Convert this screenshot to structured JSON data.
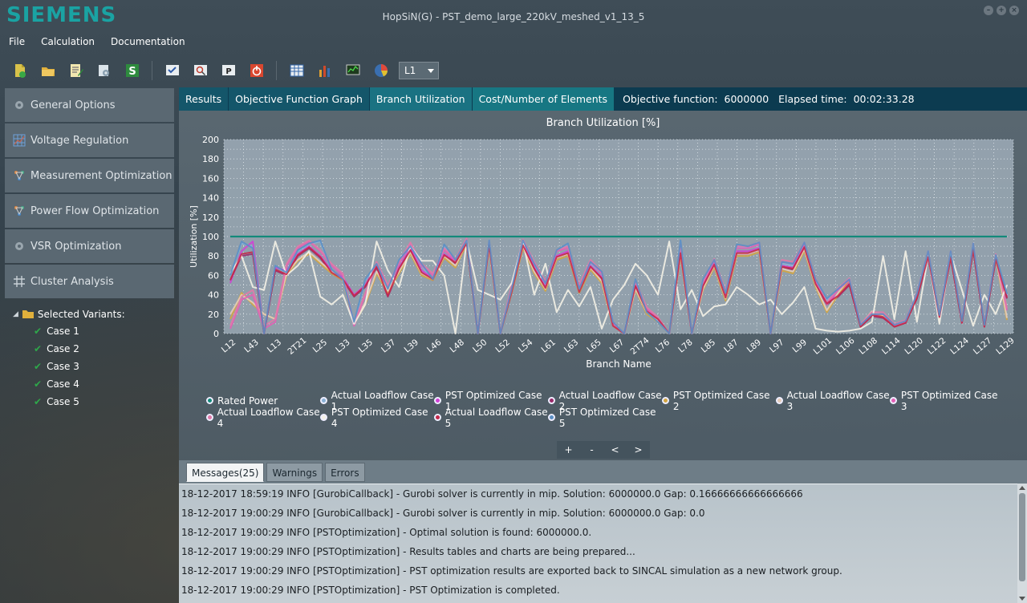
{
  "app": {
    "logo": "SIEMENS",
    "window_title": "HopSiN(G) - PST_demo_large_220kV_meshed_v1_13_5"
  },
  "menu": [
    "File",
    "Calculation",
    "Documentation"
  ],
  "toolbar": {
    "icons": [
      "new-file-icon",
      "open-folder-icon",
      "edit-document-icon",
      "settings-icon",
      "sincal-s-icon",
      "view-check-icon",
      "search-settings-icon",
      "print-p-icon",
      "power-stop-icon",
      "table-view-icon",
      "bar-chart-icon",
      "monitor-graph-icon",
      "pie-chart-icon"
    ],
    "level_select": "L1"
  },
  "sidebar": {
    "items": [
      {
        "label": "General Options",
        "icon": "gear-icon"
      },
      {
        "label": "Voltage Regulation",
        "icon": "grid-chart-icon"
      },
      {
        "label": "Measurement Optimization",
        "icon": "network-nodes-icon"
      },
      {
        "label": "Power Flow Optimization",
        "icon": "network-nodes-icon"
      },
      {
        "label": "VSR Optimization",
        "icon": "gear-icon"
      },
      {
        "label": "Cluster Analysis",
        "icon": "hash-grid-icon"
      }
    ],
    "tree": {
      "root_label": "Selected Variants:",
      "cases": [
        "Case 1",
        "Case 2",
        "Case 3",
        "Case 4",
        "Case 5"
      ]
    }
  },
  "tabs": [
    "Results",
    "Objective Function Graph",
    "Branch Utilization",
    "Cost/Number of Elements"
  ],
  "active_tab": "Branch Utilization",
  "objective": {
    "text": "Objective function:  6000000   Elapsed time:  00:02:33.28"
  },
  "chart_nav": [
    "+",
    "-",
    "<",
    ">"
  ],
  "chart_data": {
    "type": "line",
    "title": "Branch Utilization [%]",
    "xlabel": "Branch Name",
    "ylabel": "Utilization [%]",
    "ylim": [
      0,
      200
    ],
    "yticks": [
      0,
      20,
      40,
      60,
      80,
      100,
      120,
      140,
      160,
      180,
      200
    ],
    "grid": true,
    "legend_position": "bottom",
    "x_tick_labels": [
      "L12",
      "L43",
      "L13",
      "2T21",
      "L25",
      "L33",
      "L35",
      "L37",
      "L39",
      "L46",
      "L48",
      "L50",
      "L52",
      "L54",
      "L61",
      "L63",
      "L65",
      "L67",
      "2T74",
      "L76",
      "L78",
      "L85",
      "L87",
      "L89",
      "L97",
      "L99",
      "L101",
      "L106",
      "L108",
      "L114",
      "L120",
      "L122",
      "L124",
      "L127",
      "L129"
    ],
    "series": [
      {
        "name": "Rated Power",
        "color": "#138a7a",
        "values": [
          100,
          100,
          100,
          100,
          100,
          100,
          100,
          100,
          100,
          100,
          100,
          100,
          100,
          100,
          100,
          100,
          100,
          100,
          100,
          100,
          100,
          100,
          100,
          100,
          100,
          100,
          100,
          100,
          100,
          100,
          100,
          100,
          100,
          100,
          100,
          100,
          100,
          100,
          100,
          100,
          100,
          100,
          100,
          100,
          100,
          100,
          100,
          100,
          100,
          100,
          100,
          100,
          100,
          100,
          100,
          100,
          100,
          100,
          100,
          100,
          100,
          100,
          100,
          100,
          100,
          100,
          100,
          100,
          100,
          100
        ]
      },
      {
        "name": "Actual Loadflow Case 1",
        "color": "#8ab2d6",
        "values": [
          60,
          93,
          90,
          0,
          70,
          62,
          85,
          92,
          95,
          65,
          55,
          10,
          55,
          70,
          45,
          75,
          88,
          70,
          55,
          90,
          75,
          95,
          0,
          95,
          0,
          45,
          95,
          70,
          50,
          85,
          92,
          45,
          72,
          62,
          10,
          0,
          55,
          20,
          12,
          0,
          95,
          0,
          55,
          75,
          40,
          90,
          88,
          92,
          0,
          72,
          70,
          92,
          55,
          35,
          45,
          55,
          8,
          20,
          20,
          8,
          12,
          40,
          84,
          18,
          84,
          12,
          92,
          8,
          80,
          40
        ]
      },
      {
        "name": "PST Optimized Case 1",
        "color": "#d23fd6",
        "values": [
          52,
          85,
          95,
          0,
          68,
          65,
          82,
          90,
          80,
          65,
          58,
          40,
          50,
          70,
          40,
          68,
          88,
          65,
          57,
          82,
          75,
          95,
          0,
          92,
          0,
          45,
          92,
          68,
          48,
          80,
          85,
          45,
          70,
          58,
          8,
          0,
          50,
          25,
          15,
          0,
          85,
          0,
          50,
          72,
          38,
          85,
          85,
          88,
          0,
          70,
          68,
          90,
          52,
          32,
          40,
          52,
          8,
          20,
          18,
          8,
          12,
          38,
          80,
          18,
          80,
          12,
          88,
          8,
          78,
          38
        ]
      },
      {
        "name": "Actual Loadflow Case 2",
        "color": "#9a2a6a",
        "values": [
          55,
          80,
          82,
          0,
          65,
          60,
          80,
          88,
          78,
          62,
          55,
          38,
          48,
          68,
          38,
          66,
          85,
          62,
          55,
          80,
          72,
          92,
          0,
          90,
          0,
          42,
          90,
          66,
          46,
          78,
          82,
          42,
          68,
          56,
          8,
          0,
          48,
          22,
          14,
          0,
          82,
          0,
          48,
          70,
          36,
          82,
          82,
          86,
          0,
          68,
          66,
          88,
          50,
          30,
          38,
          50,
          7,
          18,
          16,
          7,
          11,
          36,
          78,
          16,
          78,
          11,
          86,
          7,
          76,
          36
        ]
      },
      {
        "name": "PST Optimized Case 2",
        "color": "#d4a640",
        "values": [
          15,
          42,
          30,
          20,
          15,
          60,
          75,
          82,
          72,
          62,
          55,
          10,
          30,
          62,
          42,
          62,
          82,
          60,
          55,
          78,
          68,
          92,
          0,
          88,
          0,
          42,
          88,
          62,
          44,
          76,
          80,
          42,
          66,
          52,
          8,
          0,
          45,
          20,
          12,
          0,
          80,
          0,
          45,
          68,
          34,
          80,
          80,
          84,
          0,
          65,
          62,
          85,
          48,
          22,
          40,
          55,
          8,
          22,
          18,
          8,
          12,
          38,
          80,
          16,
          80,
          12,
          88,
          8,
          78,
          14
        ]
      },
      {
        "name": "Actual Loadflow Case 3",
        "color": "#e6cdbb",
        "values": [
          20,
          40,
          32,
          20,
          15,
          62,
          76,
          84,
          74,
          64,
          56,
          12,
          32,
          64,
          44,
          64,
          84,
          62,
          56,
          80,
          70,
          94,
          0,
          90,
          0,
          44,
          90,
          64,
          46,
          78,
          82,
          44,
          68,
          54,
          9,
          0,
          46,
          22,
          13,
          0,
          82,
          0,
          46,
          70,
          36,
          82,
          82,
          86,
          0,
          67,
          64,
          87,
          50,
          24,
          42,
          57,
          9,
          23,
          19,
          9,
          13,
          40,
          82,
          17,
          82,
          13,
          90,
          9,
          80,
          16
        ]
      },
      {
        "name": "PST Optimized Case 3",
        "color": "#e35fb5",
        "values": [
          5,
          35,
          40,
          5,
          12,
          70,
          88,
          95,
          85,
          70,
          60,
          8,
          40,
          72,
          48,
          72,
          92,
          70,
          60,
          86,
          75,
          98,
          0,
          94,
          0,
          48,
          96,
          72,
          52,
          85,
          88,
          48,
          74,
          62,
          10,
          0,
          52,
          25,
          15,
          0,
          90,
          0,
          52,
          75,
          42,
          88,
          88,
          92,
          0,
          74,
          72,
          92,
          55,
          30,
          45,
          55,
          8,
          20,
          20,
          8,
          12,
          40,
          84,
          18,
          84,
          12,
          92,
          8,
          80,
          24
        ]
      },
      {
        "name": "Actual Loadflow Case 4",
        "color": "#e07aa8",
        "values": [
          8,
          38,
          45,
          8,
          15,
          72,
          90,
          96,
          86,
          72,
          62,
          10,
          42,
          74,
          50,
          74,
          94,
          72,
          62,
          88,
          77,
          98,
          0,
          95,
          0,
          50,
          97,
          74,
          54,
          86,
          90,
          50,
          76,
          64,
          12,
          0,
          54,
          27,
          17,
          0,
          92,
          0,
          54,
          77,
          44,
          90,
          90,
          94,
          0,
          76,
          74,
          94,
          57,
          32,
          47,
          57,
          10,
          22,
          22,
          10,
          14,
          42,
          85,
          20,
          85,
          14,
          93,
          10,
          82,
          26
        ]
      },
      {
        "name": "PST Optimized Case 4",
        "color": "#f4f1e6",
        "values": [
          62,
          80,
          48,
          45,
          95,
          60,
          70,
          85,
          38,
          30,
          40,
          10,
          30,
          95,
          65,
          48,
          90,
          75,
          75,
          60,
          0,
          95,
          45,
          40,
          35,
          52,
          95,
          40,
          72,
          22,
          45,
          28,
          48,
          5,
          35,
          50,
          72,
          60,
          40,
          95,
          25,
          45,
          18,
          28,
          30,
          48,
          40,
          30,
          35,
          20,
          32,
          48,
          5,
          3,
          2,
          3,
          5,
          12,
          80,
          15,
          85,
          12,
          80,
          10,
          82,
          45,
          8,
          40,
          20,
          50
        ]
      },
      {
        "name": "Actual Loadflow Case 5",
        "color": "#c42a4a",
        "values": [
          55,
          82,
          84,
          0,
          66,
          61,
          81,
          89,
          79,
          63,
          56,
          39,
          49,
          69,
          39,
          67,
          86,
          63,
          56,
          81,
          73,
          93,
          0,
          91,
          0,
          43,
          91,
          67,
          47,
          79,
          83,
          43,
          69,
          57,
          8,
          0,
          49,
          23,
          15,
          0,
          83,
          0,
          49,
          71,
          37,
          83,
          83,
          87,
          0,
          69,
          67,
          89,
          51,
          31,
          39,
          51,
          7,
          19,
          17,
          7,
          11,
          37,
          79,
          17,
          79,
          11,
          87,
          7,
          77,
          37
        ]
      },
      {
        "name": "PST Optimized Case 5",
        "color": "#5b8fc4",
        "values": [
          60,
          95,
          88,
          0,
          70,
          63,
          86,
          93,
          96,
          66,
          56,
          12,
          56,
          72,
          46,
          76,
          90,
          72,
          56,
          92,
          76,
          96,
          0,
          96,
          0,
          46,
          96,
          72,
          52,
          86,
          93,
          46,
          74,
          64,
          12,
          0,
          56,
          22,
          12,
          0,
          96,
          0,
          56,
          76,
          42,
          92,
          90,
          94,
          0,
          74,
          72,
          94,
          56,
          36,
          46,
          56,
          9,
          20,
          20,
          9,
          13,
          41,
          85,
          19,
          85,
          13,
          93,
          9,
          81,
          41
        ]
      }
    ]
  },
  "legend_rows": [
    [
      "Rated Power",
      "Actual Loadflow Case 1",
      "PST Optimized Case 1",
      "Actual Loadflow Case 2",
      "PST Optimized Case 2",
      "Actual Loadflow Case 3",
      "PST Optimized Case 3"
    ],
    [
      "Actual Loadflow Case 4",
      "PST Optimized Case 4",
      "Actual Loadflow Case 5",
      "PST Optimized Case 5"
    ]
  ],
  "messages": {
    "tabs": [
      "Messages(25)",
      "Warnings",
      "Errors"
    ],
    "lines": [
      "18-12-2017 18:59:19 INFO [GurobiCallback] - Gurobi solver is currently in mip. Solution: 6000000.0  Gap: 0.16666666666666666",
      "18-12-2017 19:00:29 INFO [GurobiCallback] - Gurobi solver is currently in mip. Solution: 6000000.0  Gap: 0.0",
      "18-12-2017 19:00:29 INFO [PSTOptimization] - Optimal solution is found: 6000000.0.",
      "18-12-2017 19:00:29 INFO [PSTOptimization] - Results tables and charts are being prepared...",
      "18-12-2017 19:00:29 INFO [PSTOptimization] - PST optimization results are exported back to SINCAL simulation as a new network group.",
      "18-12-2017 19:00:29 INFO [PSTOptimization] - PST Optimization is completed."
    ]
  }
}
